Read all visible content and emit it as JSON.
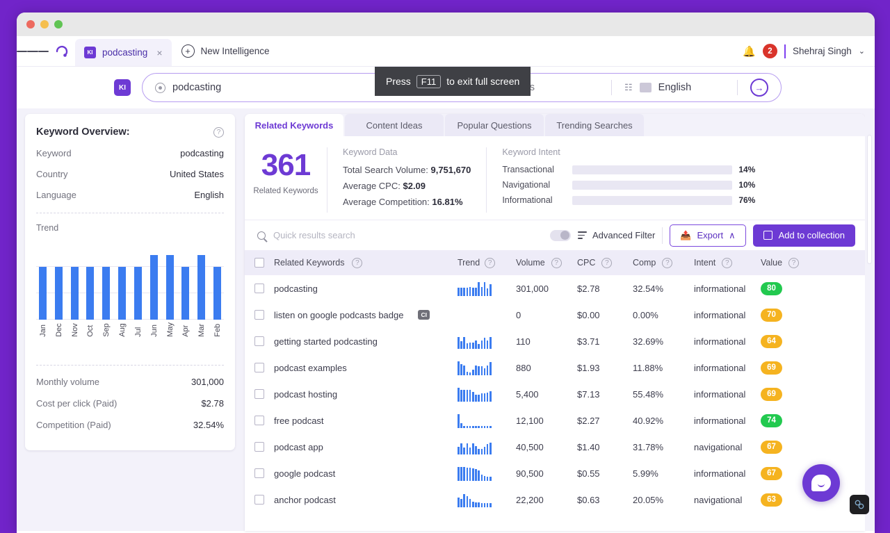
{
  "browser": {
    "window_controls": [
      "close",
      "minimize",
      "maximize"
    ],
    "menu_icon": "hamburger-icon",
    "logo_icon": "keyword-insights-logo"
  },
  "tabstrip": {
    "tab": {
      "badge": "KI",
      "title": "podcasting",
      "close": "×"
    },
    "new_tab_label": "New Intelligence",
    "notification_count": "2",
    "user_name": "Shehraj Singh",
    "caret": "⌄"
  },
  "fullscreen_toast": {
    "prefix": "Press",
    "key": "F11",
    "suffix": "to exit full screen"
  },
  "searchbar": {
    "ki_label": "KI",
    "query": "podcasting",
    "country": "United States",
    "language": "English",
    "enter_icon": "enter-arrow-icon"
  },
  "keyword_overview": {
    "title": "Keyword Overview:",
    "rows": [
      {
        "label": "Keyword",
        "value": "podcasting"
      },
      {
        "label": "Country",
        "value": "United States"
      },
      {
        "label": "Language",
        "value": "English"
      }
    ],
    "trend_label": "Trend",
    "stats": [
      {
        "label": "Monthly volume",
        "value": "301,000"
      },
      {
        "label": "Cost per click (Paid)",
        "value": "$2.78"
      },
      {
        "label": "Competition (Paid)",
        "value": "32.54%"
      }
    ]
  },
  "chart_data": {
    "type": "bar",
    "title": "Trend",
    "categories": [
      "Jan",
      "Dec",
      "Nov",
      "Oct",
      "Sep",
      "Aug",
      "Jul",
      "Jun",
      "May",
      "Apr",
      "Mar",
      "Feb"
    ],
    "values": [
      301000,
      301000,
      301000,
      301000,
      301000,
      301000,
      301000,
      368000,
      368000,
      301000,
      368000,
      301000
    ],
    "xlabel": "",
    "ylabel": "",
    "ylim": [
      0,
      400000
    ],
    "grid": true,
    "legend": "none",
    "color": "#3b7cf0"
  },
  "tabs": [
    {
      "label": "Related Keywords",
      "active": true
    },
    {
      "label": "Content Ideas",
      "active": false
    },
    {
      "label": "Popular Questions",
      "active": false
    },
    {
      "label": "Trending Searches",
      "active": false
    }
  ],
  "summary": {
    "count": "361",
    "count_label": "Related Keywords",
    "keyword_data": {
      "title": "Keyword Data",
      "lines": [
        {
          "label": "Total Search Volume:",
          "value": "9,751,670"
        },
        {
          "label": "Average CPC:",
          "value": "$2.09"
        },
        {
          "label": "Average Competition:",
          "value": "16.81%"
        }
      ]
    },
    "keyword_intent": {
      "title": "Keyword Intent",
      "rows": [
        {
          "label": "Transactional",
          "pct": "14%",
          "fill": 14,
          "color": "#cf3423"
        },
        {
          "label": "Navigational",
          "pct": "10%",
          "fill": 10,
          "color": "#f9b416"
        },
        {
          "label": "Informational",
          "pct": "76%",
          "fill": 76,
          "color": "#2ecc4d"
        }
      ]
    }
  },
  "toolbar": {
    "search_placeholder": "Quick results search",
    "search_value": "",
    "advanced_filter_label": "Advanced Filter",
    "export_label": "Export",
    "export_caret": "∧",
    "add_to_collection_label": "Add to collection"
  },
  "table": {
    "columns": [
      {
        "label": "Related Keywords",
        "help": true
      },
      {
        "label": "Trend",
        "help": true
      },
      {
        "label": "Volume",
        "help": true
      },
      {
        "label": "CPC",
        "help": true
      },
      {
        "label": "Comp",
        "help": true
      },
      {
        "label": "Intent",
        "help": true
      },
      {
        "label": "Value",
        "help": true
      }
    ],
    "rows": [
      {
        "keyword": "podcasting",
        "tag": "",
        "spark": [
          12,
          12,
          12,
          12,
          13,
          12,
          12,
          20,
          13,
          20,
          11,
          17
        ],
        "volume": "301,000",
        "cpc": "$2.78",
        "comp": "32.54%",
        "intent": "informational",
        "value": "80",
        "value_color": "#22c94f"
      },
      {
        "keyword": "listen on google podcasts badge",
        "tag": "CI",
        "spark": [],
        "volume": "0",
        "cpc": "$0.00",
        "comp": "0.00%",
        "intent": "informational",
        "value": "70",
        "value_color": "#f5b320"
      },
      {
        "keyword": "getting started podcasting",
        "tag": "",
        "spark": [
          17,
          11,
          17,
          8,
          9,
          9,
          12,
          7,
          12,
          16,
          12,
          17
        ],
        "volume": "110",
        "cpc": "$3.71",
        "comp": "32.69%",
        "intent": "informational",
        "value": "64",
        "value_color": "#f5b320"
      },
      {
        "keyword": "podcast examples",
        "tag": "",
        "spark": [
          20,
          16,
          14,
          5,
          4,
          8,
          14,
          13,
          13,
          10,
          14,
          19
        ],
        "volume": "880",
        "cpc": "$1.93",
        "comp": "11.88%",
        "intent": "informational",
        "value": "69",
        "value_color": "#f5b320"
      },
      {
        "keyword": "podcast hosting",
        "tag": "",
        "spark": [
          20,
          17,
          17,
          17,
          17,
          14,
          10,
          10,
          12,
          12,
          13,
          15
        ],
        "volume": "5,400",
        "cpc": "$7.13",
        "comp": "55.48%",
        "intent": "informational",
        "value": "69",
        "value_color": "#f5b320"
      },
      {
        "keyword": "free podcast",
        "tag": "",
        "spark": [
          20,
          7,
          3,
          3,
          3,
          3,
          3,
          3,
          3,
          3,
          3,
          3
        ],
        "volume": "12,100",
        "cpc": "$2.27",
        "comp": "40.92%",
        "intent": "informational",
        "value": "74",
        "value_color": "#22c94f"
      },
      {
        "keyword": "podcast app",
        "tag": "",
        "spark": [
          11,
          16,
          10,
          16,
          10,
          16,
          12,
          8,
          8,
          11,
          15,
          17
        ],
        "volume": "40,500",
        "cpc": "$1.40",
        "comp": "31.78%",
        "intent": "navigational",
        "value": "67",
        "value_color": "#f5b320"
      },
      {
        "keyword": "google podcast",
        "tag": "",
        "spark": [
          20,
          20,
          20,
          19,
          19,
          18,
          17,
          15,
          9,
          7,
          6,
          6
        ],
        "volume": "90,500",
        "cpc": "$0.55",
        "comp": "5.99%",
        "intent": "informational",
        "value": "67",
        "value_color": "#f5b320"
      },
      {
        "keyword": "anchor podcast",
        "tag": "",
        "spark": [
          14,
          12,
          19,
          16,
          12,
          8,
          7,
          7,
          6,
          6,
          6,
          6
        ],
        "volume": "22,200",
        "cpc": "$0.63",
        "comp": "20.05%",
        "intent": "navigational",
        "value": "63",
        "value_color": "#f5b320"
      }
    ]
  },
  "widgets": {
    "chat_icon": "chat-bubble-icon",
    "devtool_icon": "link-chain-icon"
  }
}
